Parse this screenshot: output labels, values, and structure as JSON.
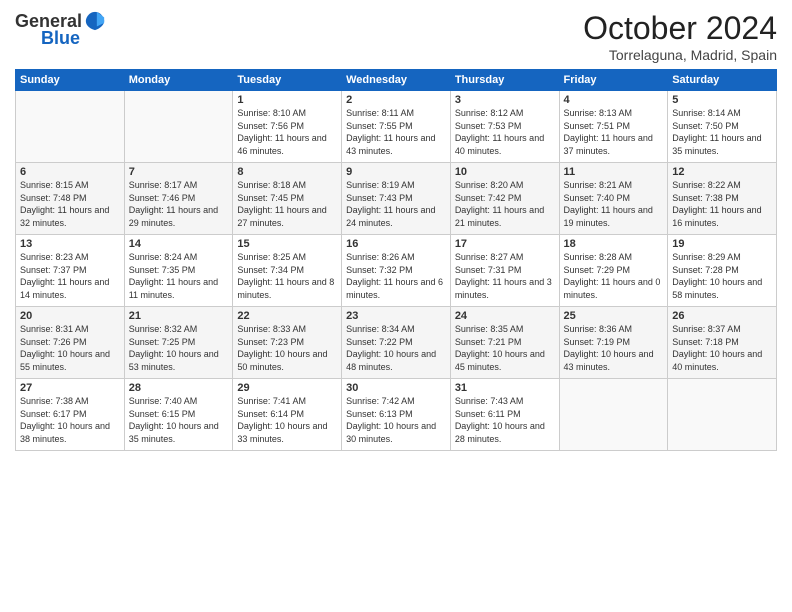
{
  "logo": {
    "general": "General",
    "blue": "Blue"
  },
  "header": {
    "month": "October 2024",
    "location": "Torrelaguna, Madrid, Spain"
  },
  "weekdays": [
    "Sunday",
    "Monday",
    "Tuesday",
    "Wednesday",
    "Thursday",
    "Friday",
    "Saturday"
  ],
  "weeks": [
    [
      {
        "day": "",
        "sunrise": "",
        "sunset": "",
        "daylight": ""
      },
      {
        "day": "",
        "sunrise": "",
        "sunset": "",
        "daylight": ""
      },
      {
        "day": "1",
        "sunrise": "Sunrise: 8:10 AM",
        "sunset": "Sunset: 7:56 PM",
        "daylight": "Daylight: 11 hours and 46 minutes."
      },
      {
        "day": "2",
        "sunrise": "Sunrise: 8:11 AM",
        "sunset": "Sunset: 7:55 PM",
        "daylight": "Daylight: 11 hours and 43 minutes."
      },
      {
        "day": "3",
        "sunrise": "Sunrise: 8:12 AM",
        "sunset": "Sunset: 7:53 PM",
        "daylight": "Daylight: 11 hours and 40 minutes."
      },
      {
        "day": "4",
        "sunrise": "Sunrise: 8:13 AM",
        "sunset": "Sunset: 7:51 PM",
        "daylight": "Daylight: 11 hours and 37 minutes."
      },
      {
        "day": "5",
        "sunrise": "Sunrise: 8:14 AM",
        "sunset": "Sunset: 7:50 PM",
        "daylight": "Daylight: 11 hours and 35 minutes."
      }
    ],
    [
      {
        "day": "6",
        "sunrise": "Sunrise: 8:15 AM",
        "sunset": "Sunset: 7:48 PM",
        "daylight": "Daylight: 11 hours and 32 minutes."
      },
      {
        "day": "7",
        "sunrise": "Sunrise: 8:17 AM",
        "sunset": "Sunset: 7:46 PM",
        "daylight": "Daylight: 11 hours and 29 minutes."
      },
      {
        "day": "8",
        "sunrise": "Sunrise: 8:18 AM",
        "sunset": "Sunset: 7:45 PM",
        "daylight": "Daylight: 11 hours and 27 minutes."
      },
      {
        "day": "9",
        "sunrise": "Sunrise: 8:19 AM",
        "sunset": "Sunset: 7:43 PM",
        "daylight": "Daylight: 11 hours and 24 minutes."
      },
      {
        "day": "10",
        "sunrise": "Sunrise: 8:20 AM",
        "sunset": "Sunset: 7:42 PM",
        "daylight": "Daylight: 11 hours and 21 minutes."
      },
      {
        "day": "11",
        "sunrise": "Sunrise: 8:21 AM",
        "sunset": "Sunset: 7:40 PM",
        "daylight": "Daylight: 11 hours and 19 minutes."
      },
      {
        "day": "12",
        "sunrise": "Sunrise: 8:22 AM",
        "sunset": "Sunset: 7:38 PM",
        "daylight": "Daylight: 11 hours and 16 minutes."
      }
    ],
    [
      {
        "day": "13",
        "sunrise": "Sunrise: 8:23 AM",
        "sunset": "Sunset: 7:37 PM",
        "daylight": "Daylight: 11 hours and 14 minutes."
      },
      {
        "day": "14",
        "sunrise": "Sunrise: 8:24 AM",
        "sunset": "Sunset: 7:35 PM",
        "daylight": "Daylight: 11 hours and 11 minutes."
      },
      {
        "day": "15",
        "sunrise": "Sunrise: 8:25 AM",
        "sunset": "Sunset: 7:34 PM",
        "daylight": "Daylight: 11 hours and 8 minutes."
      },
      {
        "day": "16",
        "sunrise": "Sunrise: 8:26 AM",
        "sunset": "Sunset: 7:32 PM",
        "daylight": "Daylight: 11 hours and 6 minutes."
      },
      {
        "day": "17",
        "sunrise": "Sunrise: 8:27 AM",
        "sunset": "Sunset: 7:31 PM",
        "daylight": "Daylight: 11 hours and 3 minutes."
      },
      {
        "day": "18",
        "sunrise": "Sunrise: 8:28 AM",
        "sunset": "Sunset: 7:29 PM",
        "daylight": "Daylight: 11 hours and 0 minutes."
      },
      {
        "day": "19",
        "sunrise": "Sunrise: 8:29 AM",
        "sunset": "Sunset: 7:28 PM",
        "daylight": "Daylight: 10 hours and 58 minutes."
      }
    ],
    [
      {
        "day": "20",
        "sunrise": "Sunrise: 8:31 AM",
        "sunset": "Sunset: 7:26 PM",
        "daylight": "Daylight: 10 hours and 55 minutes."
      },
      {
        "day": "21",
        "sunrise": "Sunrise: 8:32 AM",
        "sunset": "Sunset: 7:25 PM",
        "daylight": "Daylight: 10 hours and 53 minutes."
      },
      {
        "day": "22",
        "sunrise": "Sunrise: 8:33 AM",
        "sunset": "Sunset: 7:23 PM",
        "daylight": "Daylight: 10 hours and 50 minutes."
      },
      {
        "day": "23",
        "sunrise": "Sunrise: 8:34 AM",
        "sunset": "Sunset: 7:22 PM",
        "daylight": "Daylight: 10 hours and 48 minutes."
      },
      {
        "day": "24",
        "sunrise": "Sunrise: 8:35 AM",
        "sunset": "Sunset: 7:21 PM",
        "daylight": "Daylight: 10 hours and 45 minutes."
      },
      {
        "day": "25",
        "sunrise": "Sunrise: 8:36 AM",
        "sunset": "Sunset: 7:19 PM",
        "daylight": "Daylight: 10 hours and 43 minutes."
      },
      {
        "day": "26",
        "sunrise": "Sunrise: 8:37 AM",
        "sunset": "Sunset: 7:18 PM",
        "daylight": "Daylight: 10 hours and 40 minutes."
      }
    ],
    [
      {
        "day": "27",
        "sunrise": "Sunrise: 7:38 AM",
        "sunset": "Sunset: 6:17 PM",
        "daylight": "Daylight: 10 hours and 38 minutes."
      },
      {
        "day": "28",
        "sunrise": "Sunrise: 7:40 AM",
        "sunset": "Sunset: 6:15 PM",
        "daylight": "Daylight: 10 hours and 35 minutes."
      },
      {
        "day": "29",
        "sunrise": "Sunrise: 7:41 AM",
        "sunset": "Sunset: 6:14 PM",
        "daylight": "Daylight: 10 hours and 33 minutes."
      },
      {
        "day": "30",
        "sunrise": "Sunrise: 7:42 AM",
        "sunset": "Sunset: 6:13 PM",
        "daylight": "Daylight: 10 hours and 30 minutes."
      },
      {
        "day": "31",
        "sunrise": "Sunrise: 7:43 AM",
        "sunset": "Sunset: 6:11 PM",
        "daylight": "Daylight: 10 hours and 28 minutes."
      },
      {
        "day": "",
        "sunrise": "",
        "sunset": "",
        "daylight": ""
      },
      {
        "day": "",
        "sunrise": "",
        "sunset": "",
        "daylight": ""
      }
    ]
  ]
}
